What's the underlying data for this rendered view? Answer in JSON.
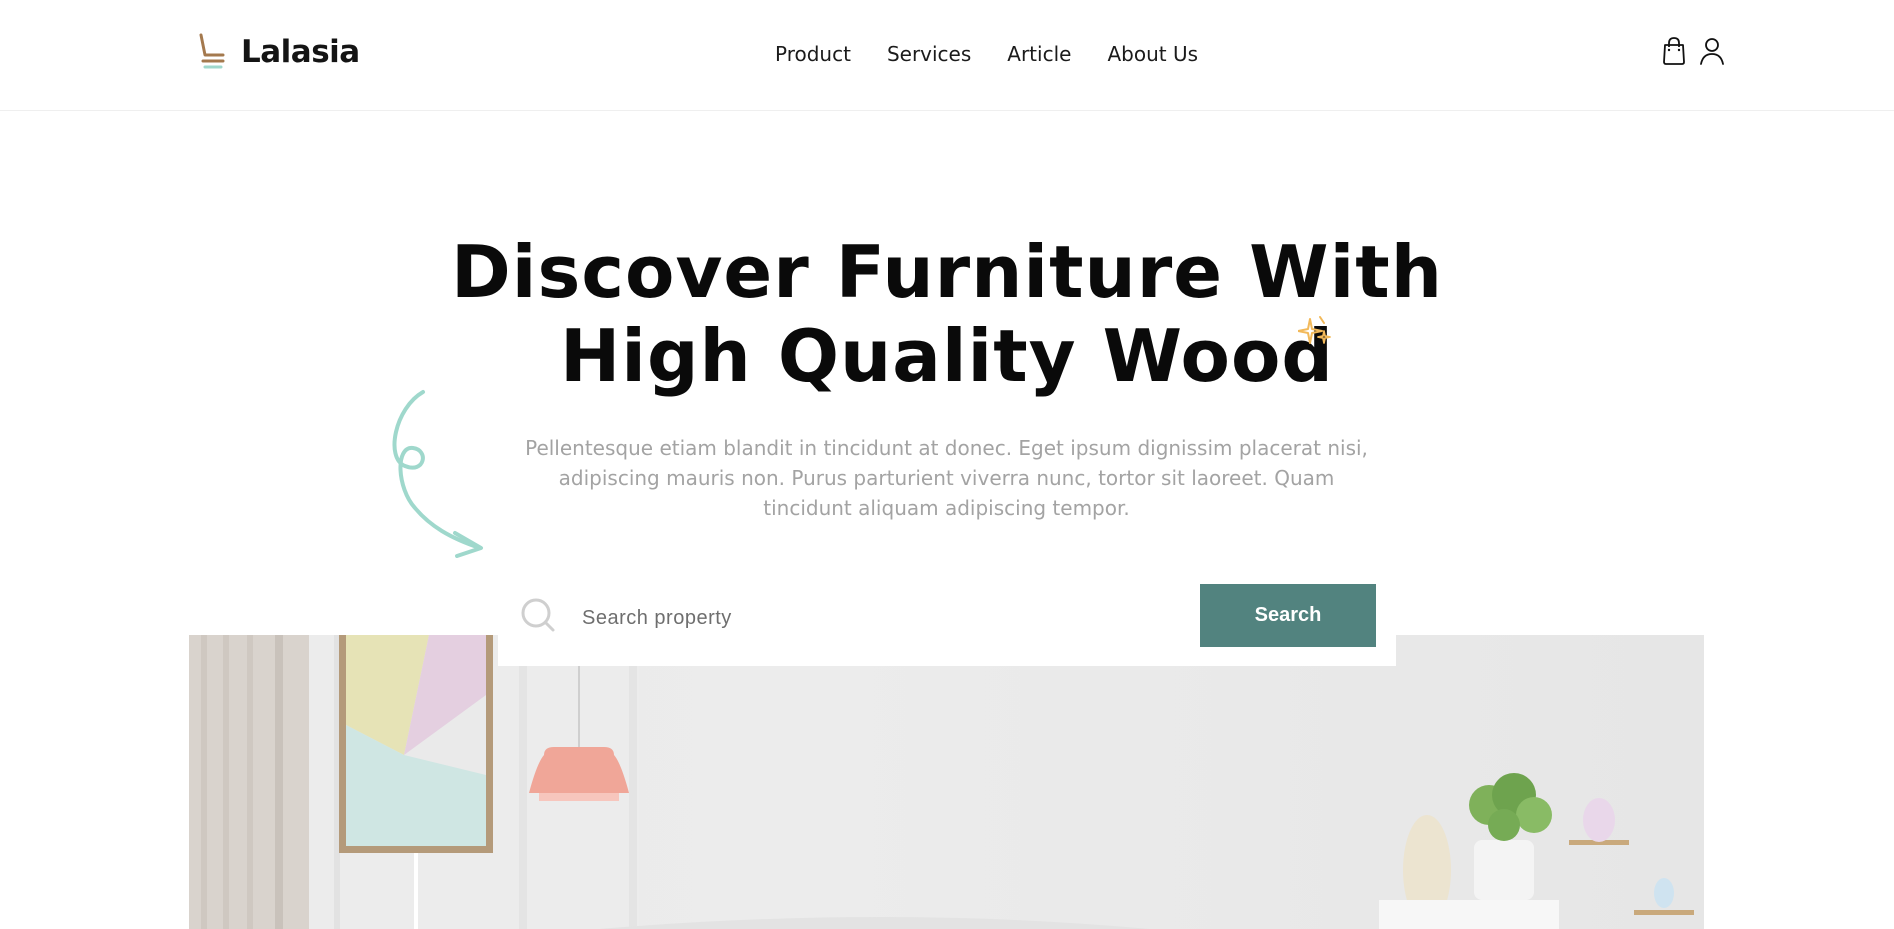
{
  "brand": {
    "name": "Lalasia",
    "logo_icon": "chair-logo-icon"
  },
  "nav": {
    "items": [
      {
        "label": "Product"
      },
      {
        "label": "Services"
      },
      {
        "label": "Article"
      },
      {
        "label": "About Us"
      }
    ]
  },
  "header_icons": {
    "cart": "shopping-bag-icon",
    "user": "user-icon"
  },
  "hero": {
    "title_line1": "Discover Furniture With",
    "title_line2": "High Quality Wood",
    "subtitle": "Pellentesque etiam blandit in tincidunt at donec. Eget ipsum dignissim placerat nisi, adipiscing mauris non. Purus parturient viverra nunc, tortor sit laoreet. Quam tincidunt aliquam adipiscing tempor."
  },
  "search": {
    "placeholder": "Search property",
    "value": "",
    "button_label": "Search"
  },
  "colors": {
    "accent": "#52837f",
    "subtitle_text": "#a3a3a3",
    "doodle": "#9fd8cc",
    "sparkle": "#f2b95a",
    "logo_seat": "#a4794e",
    "logo_base": "#9fd8cc"
  }
}
